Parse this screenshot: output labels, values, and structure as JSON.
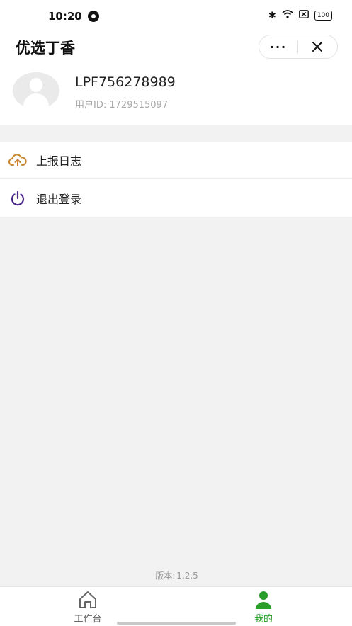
{
  "status_bar": {
    "time": "10:20",
    "battery": "100"
  },
  "header": {
    "title": "优选丁香",
    "more_label": "···",
    "close_label": "✕"
  },
  "profile": {
    "name": "LPF756278989",
    "user_id_label": "用户ID:",
    "user_id_value": "1729515097"
  },
  "menu": {
    "items": [
      {
        "label": "上报日志",
        "icon": "cloud-upload-icon",
        "color": "#c8872d"
      },
      {
        "label": "退出登录",
        "icon": "power-icon",
        "color": "#4b2a8a"
      }
    ]
  },
  "version": {
    "label": "版本:",
    "value": "1.2.5"
  },
  "tabbar": {
    "items": [
      {
        "label": "工作台",
        "icon": "home-icon",
        "active": false
      },
      {
        "label": "我的",
        "icon": "user-icon",
        "active": true
      }
    ],
    "active_color": "#2a9d2a"
  }
}
